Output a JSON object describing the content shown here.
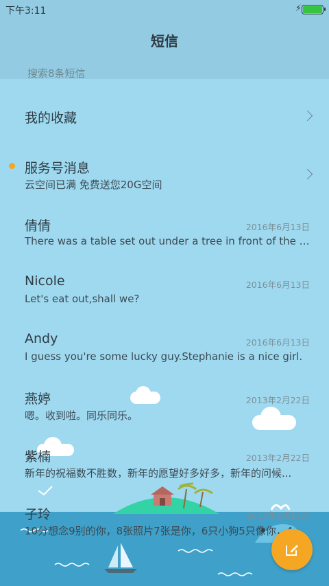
{
  "status": {
    "time": "下午3:11",
    "bolt": "⚡"
  },
  "header": {
    "title": "短信"
  },
  "search": {
    "placeholder": "搜索8条短信"
  },
  "colors": {
    "accent": "#f5a623",
    "background": "#9fd9f0",
    "sea": "#3fa0c9"
  },
  "favorites": {
    "label": "我的收藏"
  },
  "service": {
    "label": "服务号消息",
    "preview": "云空间已满 免费送您20G空间"
  },
  "messages": [
    {
      "name": "倩倩",
      "date": "2016年6月13日",
      "preview": "There was a table set out under a tree in front of the ho..."
    },
    {
      "name": "Nicole",
      "date": "2016年6月13日",
      "preview": "Let's eat out,shall we?"
    },
    {
      "name": "Andy",
      "date": "2016年6月13日",
      "preview": "I guess you're some lucky guy.Stephanie is a nice girl."
    },
    {
      "name": "燕婷",
      "date": "2013年2月22日",
      "preview": "嗯。收到啦。同乐同乐。"
    },
    {
      "name": "紫楠",
      "date": "2013年2月22日",
      "preview": "新年的祝福数不胜数，新年的愿望好多好多，新年的问候..."
    },
    {
      "name": "子玲",
      "date": "2013年2月22日",
      "preview": "10分想念9别的你，8张照片7张是你，6只小狗5只像你，4..."
    }
  ],
  "fab": {
    "icon": "compose-icon"
  }
}
